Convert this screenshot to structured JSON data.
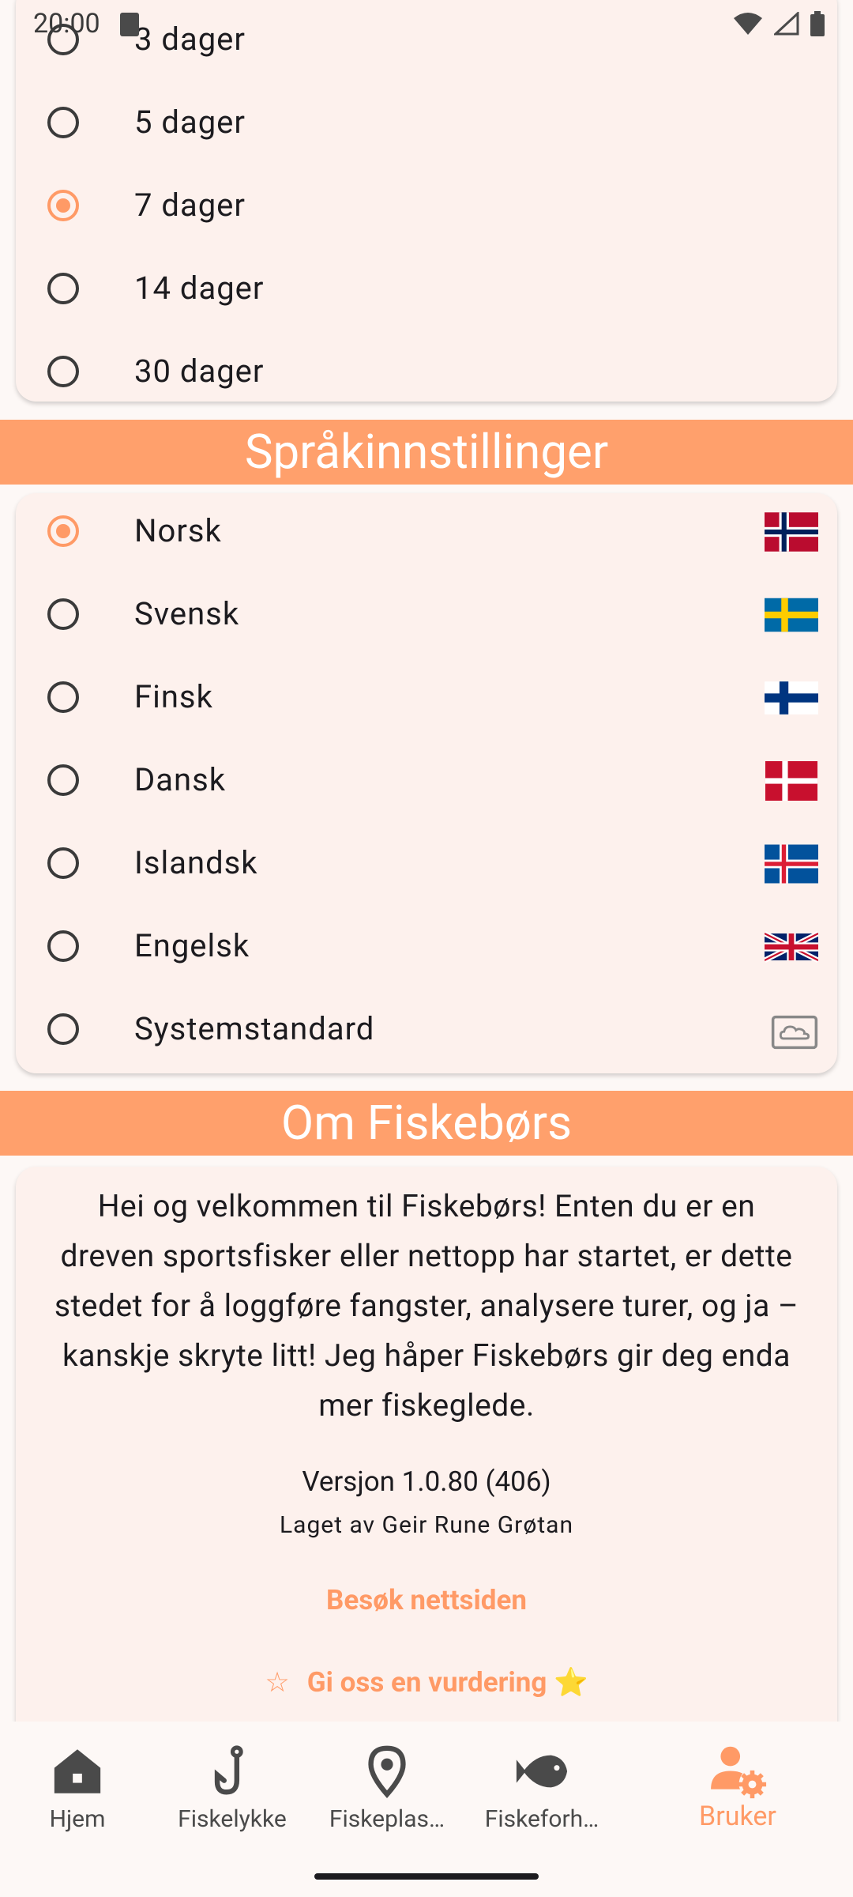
{
  "status": {
    "time": "20:00"
  },
  "duration_options": [
    {
      "label": "3 dager",
      "selected": false
    },
    {
      "label": "5 dager",
      "selected": false
    },
    {
      "label": "7 dager",
      "selected": true
    },
    {
      "label": "14 dager",
      "selected": false
    },
    {
      "label": "30 dager",
      "selected": false
    }
  ],
  "language_section": {
    "title": "Språkinnstillinger",
    "options": [
      {
        "label": "Norsk",
        "selected": true,
        "icon": "flag-norway-icon"
      },
      {
        "label": "Svensk",
        "selected": false,
        "icon": "flag-sweden-icon"
      },
      {
        "label": "Finsk",
        "selected": false,
        "icon": "flag-finland-icon"
      },
      {
        "label": "Dansk",
        "selected": false,
        "icon": "flag-denmark-icon"
      },
      {
        "label": "Islandsk",
        "selected": false,
        "icon": "flag-iceland-icon"
      },
      {
        "label": "Engelsk",
        "selected": false,
        "icon": "flag-uk-icon"
      },
      {
        "label": "Systemstandard",
        "selected": false,
        "icon": "system-default-icon"
      }
    ]
  },
  "about": {
    "title": "Om Fiskebørs",
    "text": "Hei og velkommen til Fiskebørs! Enten du er en dreven sportsfisker eller nettopp har startet, er dette stedet for å loggføre fangster, analysere turer, og ja – kanskje skryte litt! Jeg håper Fiskebørs gir deg enda mer fiskeglede.",
    "version": "Versjon 1.0.80 (406)",
    "author": "Laget av Geir Rune Grøtan",
    "website_link": "Besøk nettsiden",
    "rate_link": "Gi oss en vurdering ⭐"
  },
  "nav": {
    "items": [
      {
        "label": "Hjem",
        "icon": "home-icon"
      },
      {
        "label": "Fiskelykke",
        "icon": "fishhook-icon"
      },
      {
        "label": "Fiskeplas…",
        "icon": "location-pin-icon"
      },
      {
        "label": "Fiskeforh…",
        "icon": "fish-icon"
      },
      {
        "label": "Bruker",
        "icon": "user-settings-icon",
        "active": true
      }
    ]
  },
  "colors": {
    "accent": "#ffa06c",
    "card": "#fdf1ed",
    "background": "#fdf8f6"
  }
}
